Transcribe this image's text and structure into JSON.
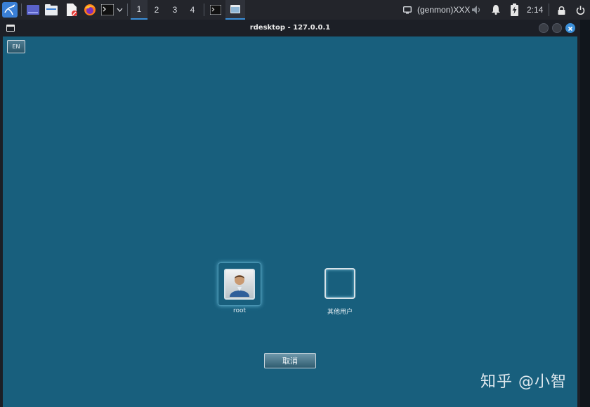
{
  "taskbar": {
    "workspaces": [
      "1",
      "2",
      "3",
      "4"
    ],
    "genmon_text": "(genmon)XXX",
    "clock": "2:14",
    "icons": [
      "kali-menu-icon",
      "show-desktop-icon",
      "file-manager-icon",
      "text-editor-icon",
      "firefox-icon",
      "terminal-icon",
      "dropdown-chevron-icon",
      "terminal-task-icon",
      "rdesktop-task-icon",
      "display-icon",
      "volume-icon",
      "notification-bell-icon",
      "battery-charging-icon",
      "lock-icon",
      "power-icon"
    ]
  },
  "window": {
    "title": "rdesktop - 127.0.0.1"
  },
  "login": {
    "lang_label": "EN",
    "users": [
      {
        "name": "root"
      },
      {
        "name": "其他用户"
      }
    ],
    "cancel_label": "取消"
  },
  "watermark": "知乎 @小智",
  "colors": {
    "desktop_bg": "#185f7d",
    "taskbar_bg": "#23252b",
    "accent": "#3b8fd9"
  }
}
